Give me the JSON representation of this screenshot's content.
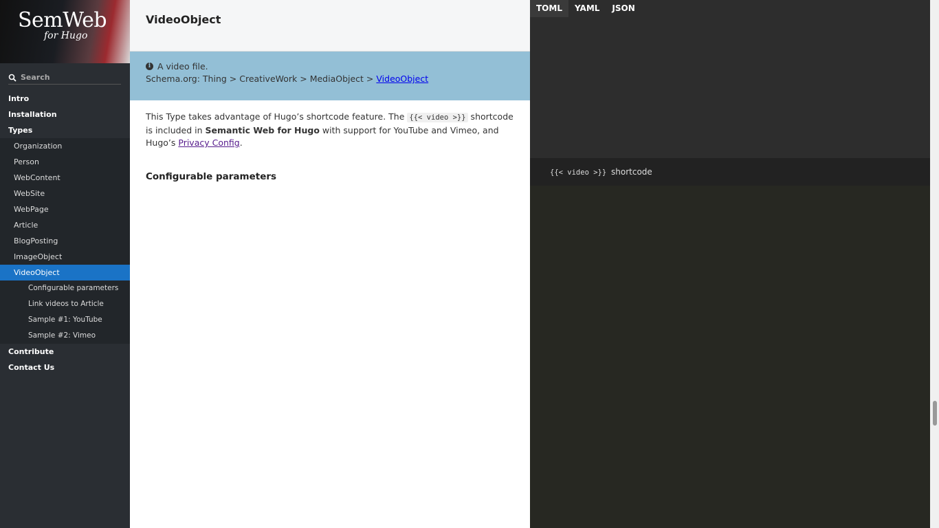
{
  "sidebar": {
    "logo_title": "SemWeb",
    "logo_subtitle": "for Hugo",
    "search_placeholder": "Search",
    "items": [
      {
        "label": "Intro"
      },
      {
        "label": "Installation"
      },
      {
        "label": "Types"
      },
      {
        "label": "Organization"
      },
      {
        "label": "Person"
      },
      {
        "label": "WebContent"
      },
      {
        "label": "WebSite"
      },
      {
        "label": "WebPage"
      },
      {
        "label": "Article"
      },
      {
        "label": "BlogPosting"
      },
      {
        "label": "ImageObject"
      },
      {
        "label": "VideoObject"
      },
      {
        "label": "Configurable parameters"
      },
      {
        "label": "Link videos to Article"
      },
      {
        "label": "Sample #1: YouTube"
      },
      {
        "label": "Sample #2: Vimeo"
      },
      {
        "label": "Contribute"
      },
      {
        "label": "Contact Us"
      }
    ]
  },
  "main": {
    "title": "VideoObject",
    "info": {
      "description": "A video file.",
      "breadcrumb_prefix": "Schema.org: Thing > CreativeWork > MediaObject > ",
      "breadcrumb_link": "VideoObject"
    },
    "intro": {
      "p1": "This Type takes advantage of Hugo’s shortcode feature. The ",
      "code": "{{< video >}}",
      "p2": " shortcode is included in ",
      "bold": "Semantic Web for Hugo",
      "p3": " with support for YouTube and Vimeo, and Hugo’s ",
      "link": "Privacy Config",
      "p4": "."
    },
    "params_heading": "Configurable parameters"
  },
  "right": {
    "tabs": [
      "TOML",
      "YAML",
      "JSON"
    ],
    "shortcode_code": "{{< video >}}",
    "shortcode_label": " shortcode"
  },
  "colors": {
    "sidebar_bg": "#2a2e33",
    "active_nav": "#1a73c6",
    "info_box": "#93bfd6",
    "code_bg": "#272822"
  }
}
